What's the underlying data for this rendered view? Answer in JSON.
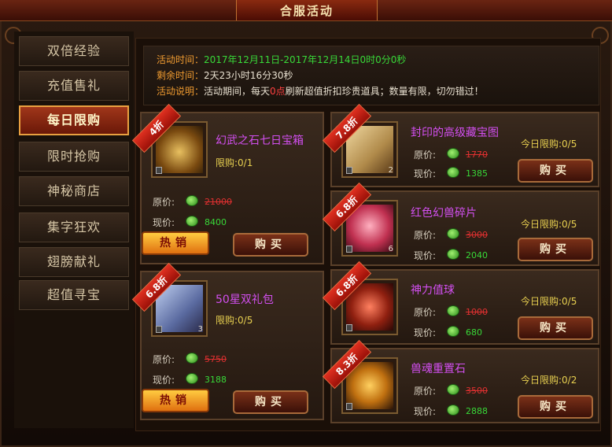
{
  "window": {
    "title": "合服活动"
  },
  "sidebar": {
    "items": [
      {
        "label": "双倍经验"
      },
      {
        "label": "充值售礼"
      },
      {
        "label": "每日限购"
      },
      {
        "label": "限时抢购"
      },
      {
        "label": "神秘商店"
      },
      {
        "label": "集字狂欢"
      },
      {
        "label": "翅膀献礼"
      },
      {
        "label": "超值寻宝"
      }
    ],
    "active_index": 2
  },
  "info": {
    "time_label": "活动时间：",
    "time_value": "2017年12月11日-2017年12月14日0时0分0秒",
    "remain_label": "剩余时间：",
    "remain_value": "2天23小时16分30秒",
    "desc_label": "活动说明：",
    "desc_pre": "活动期间，每天",
    "desc_highlight": "0点",
    "desc_post": "刷新超值折扣珍贵道具；数量有限，切勿错过！"
  },
  "labels": {
    "orig_price": "原价:",
    "now_price": "现价:",
    "buy": "购买",
    "hot": "热销",
    "today_limit": "今日限购:"
  },
  "products": {
    "big": [
      {
        "discount": "4折",
        "name": "幻武之石七日宝箱",
        "limit": "限购:0/1",
        "qty": "",
        "orig": "21000",
        "now": "8400",
        "hot": true
      },
      {
        "discount": "6.8折",
        "name": "50星双礼包",
        "limit": "限购:0/5",
        "qty": "3",
        "orig": "5750",
        "now": "3188",
        "hot": true
      }
    ],
    "small": [
      {
        "discount": "7.8折",
        "name": "封印的高级藏宝图",
        "limit": "今日限购:0/5",
        "qty": "2",
        "orig": "1770",
        "now": "1385"
      },
      {
        "discount": "6.8折",
        "name": "红色幻兽碎片",
        "limit": "今日限购:0/5",
        "qty": "6",
        "orig": "3000",
        "now": "2040"
      },
      {
        "discount": "6.8折",
        "name": "神力值球",
        "limit": "今日限购:0/5",
        "qty": "",
        "orig": "1000",
        "now": "680"
      },
      {
        "discount": "8.3折",
        "name": "兽魂重置石",
        "limit": "今日限购:0/2",
        "qty": "",
        "orig": "3500",
        "now": "2888"
      }
    ]
  },
  "colors": {
    "accent": "#ee9a30",
    "price_now": "#38d838",
    "price_old": "#e03030",
    "name": "#d24ff0",
    "limit": "#e8d050"
  }
}
